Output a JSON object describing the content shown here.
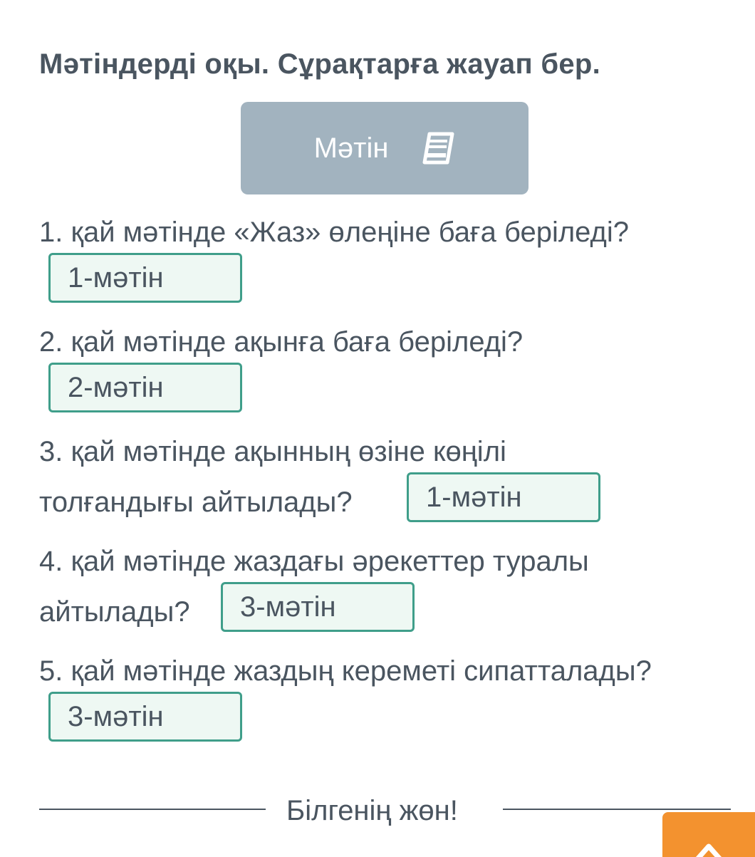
{
  "title": "Мәтіндерді оқы. Сұрақтарға жауап бер.",
  "text_button": {
    "label": "Мәтін",
    "icon": "book-icon"
  },
  "questions": [
    {
      "lines": [
        "1. қай мәтінде «Жаз» өлеңіне баға беріледі?"
      ],
      "answer": "1-мәтін"
    },
    {
      "lines": [
        "2. қай мәтінде ақынға баға беріледі?"
      ],
      "answer": "2-мәтін"
    },
    {
      "lines": [
        "3. қай мәтінде ақынның өзіне көңілі",
        "толғандығы айтылады?"
      ],
      "answer": "1-мәтін"
    },
    {
      "lines": [
        "4. қай мәтінде жаздағы әрекеттер туралы",
        "айтылады?"
      ],
      "answer": "3-мәтін"
    },
    {
      "lines": [
        "5. қай мәтінде жаздың кереметі сипатталады?"
      ],
      "answer": "3-мәтін"
    }
  ],
  "footer": {
    "text": "Білгенің жөн!"
  },
  "scroll_up_button": {
    "icon": "chevron-up-icon"
  },
  "colors": {
    "text": "#4a5560",
    "button_bg": "#a2b3bf",
    "answer_border": "#3f9e8a",
    "answer_bg": "#eef8f3",
    "accent_orange": "#f3922f"
  }
}
